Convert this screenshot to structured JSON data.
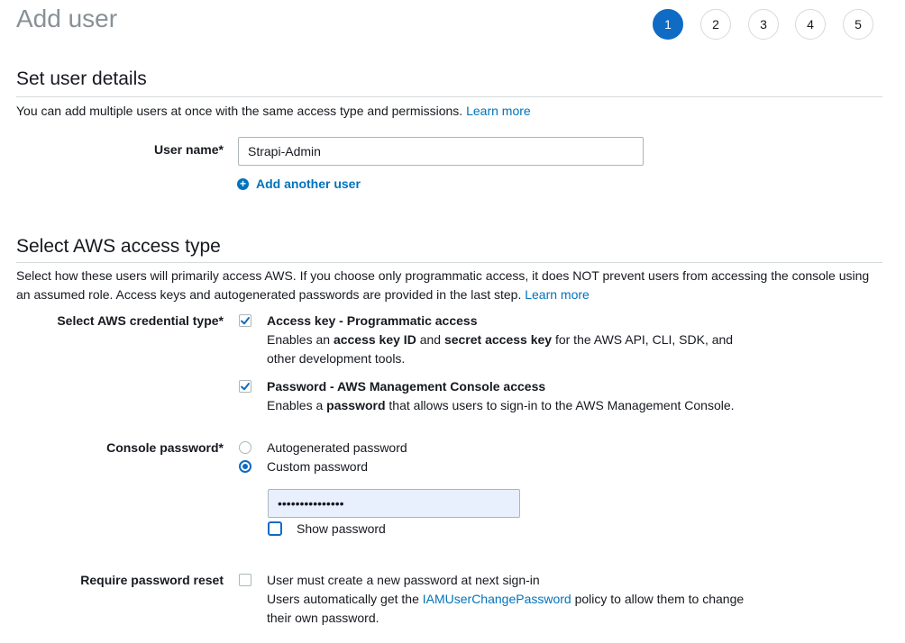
{
  "page": {
    "title": "Add user"
  },
  "steps": [
    "1",
    "2",
    "3",
    "4",
    "5"
  ],
  "details": {
    "title": "Set user details",
    "description": "You can add multiple users at once with the same access type and permissions.",
    "learn_more": "Learn more",
    "username_label": "User name*",
    "username_value": "Strapi-Admin",
    "add_another_user": "Add another user"
  },
  "access": {
    "title": "Select AWS access type",
    "description": "Select how these users will primarily access AWS. If you choose only programmatic access, it does NOT prevent users from accessing the console using an assumed role. Access keys and autogenerated passwords are provided in the last step.",
    "learn_more": "Learn more",
    "credential_label": "Select AWS credential type*",
    "programmatic": {
      "title": "Access key - Programmatic access",
      "desc_1": "Enables an ",
      "bold_1": "access key ID",
      "desc_2": " and ",
      "bold_2": "secret access key",
      "desc_3": " for the AWS API, CLI, SDK, and other development tools.",
      "checked": true
    },
    "console": {
      "title": "Password - AWS Management Console access",
      "desc_1": "Enables a ",
      "bold_1": "password",
      "desc_2": " that allows users to sign-in to the AWS Management Console.",
      "checked": true
    },
    "console_password_label": "Console password*",
    "autogenerated_label": "Autogenerated password",
    "custom_label": "Custom password",
    "password_value": "•••••••••••••••",
    "show_password_label": "Show password",
    "reset_label": "Require password reset",
    "reset_text": "User must create a new password at next sign-in",
    "reset_info_1": "Users automatically get the ",
    "reset_info_link": "IAMUserChangePassword",
    "reset_info_2": " policy to allow them to change their own password."
  },
  "colors": {
    "accent": "#0f6bc4",
    "link": "#0073bb",
    "muted_title": "#879196"
  }
}
